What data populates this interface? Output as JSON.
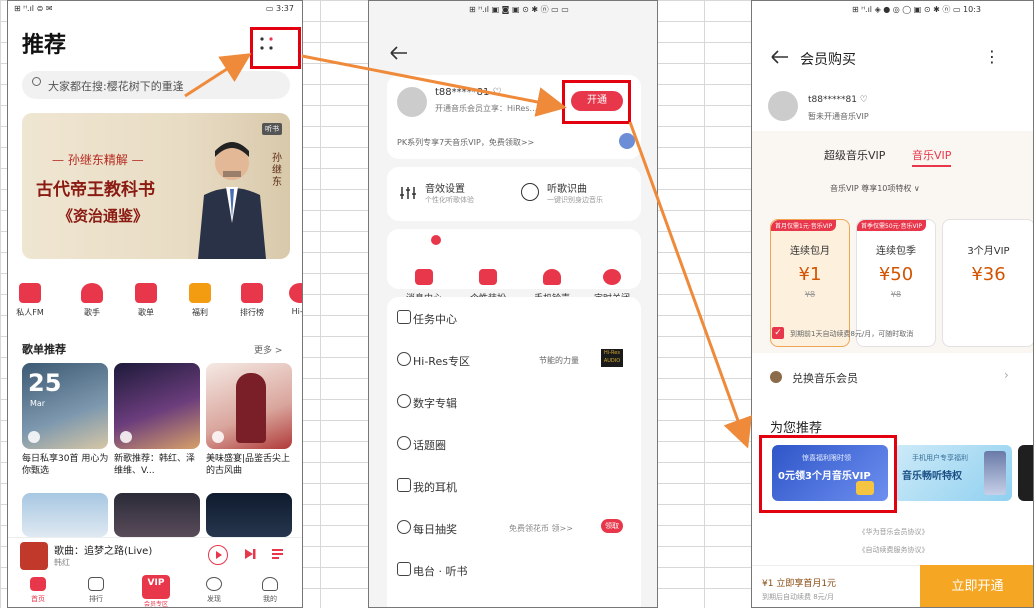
{
  "screen1": {
    "status_left": "⊞ ᴴ.ıl ⊜ ✉",
    "status_right": "▭ 3:37",
    "title": "推荐",
    "search_placeholder": "大家都在搜:樱花树下的重逢",
    "banner": {
      "badge": "听书",
      "line1": "— 孙继东精解 —",
      "line2": "古代帝王教科书",
      "line3": "《资治通鉴》",
      "side_name": "孙继东"
    },
    "quick_items": [
      "私人FM",
      "歌手",
      "歌单",
      "福利",
      "排行榜",
      "Hi-R"
    ],
    "playlist_section": {
      "title": "歌单推荐",
      "more": "更多 >"
    },
    "playlists": [
      {
        "date": "25",
        "month": "Mar",
        "caption": "每日私享30首 用心为你甄选"
      },
      {
        "caption": "新歌推荐：韩红、泽维维、V..."
      },
      {
        "caption": "美味盛宴|品鉴舌尖上的古风曲"
      }
    ],
    "player": {
      "title": "歌曲：追梦之路(Live)",
      "artist": "韩红"
    },
    "tabs": [
      "首页",
      "排行",
      "VIP",
      "发现",
      "我的"
    ],
    "vip_tab_badge": "VIP",
    "vip_tab_sub": "会员专区"
  },
  "screen2": {
    "status": "⊞ ᴴ.ıl ▣ ◙      ▣ ⊙ ✱ ⓝ ▭ ▭",
    "user_name": "t88*****81 ♡",
    "user_sub": "开通音乐会员立享：HiRes...",
    "open_button": "开通",
    "promo": "PK系列专享7天音乐VIP，免费领取>>",
    "sound_settings": {
      "title": "音效设置",
      "sub": "个性化听歌体验"
    },
    "song_id": {
      "title": "听歌识曲",
      "sub": "一键识别身边音乐"
    },
    "grid_items": [
      "消息中心",
      "个性装扮",
      "手机铃声",
      "定时关闭"
    ],
    "menu": [
      {
        "label": "任务中心",
        "right": ""
      },
      {
        "label": "Hi-Res专区",
        "right": "节能的力量"
      },
      {
        "label": "数字专辑",
        "right": ""
      },
      {
        "label": "话题圈",
        "right": ""
      },
      {
        "label": "我的耳机",
        "right": ""
      },
      {
        "label": "每日抽奖",
        "right": "免费领花币 领>>"
      },
      {
        "label": "电台 · 听书",
        "right": ""
      }
    ],
    "lottery_badge": "领取",
    "hires_badge": "Hi-Res AUDIO"
  },
  "screen3": {
    "status": "⊞ ᴴ.ıl ◈ ● ◎ ◯     ▣ ⊙ ✱ ⓝ ▭ 10:3",
    "title": "会员购买",
    "user_name": "t88*****81 ♡",
    "user_sub": "暂未开通音乐VIP",
    "tabs": [
      "超级音乐VIP",
      "音乐VIP"
    ],
    "privilege_line": "音乐VIP 尊享10项特权 ∨",
    "packages": [
      {
        "tag": "首月仅需1元·音乐VIP",
        "name": "连续包月",
        "price": "¥1",
        "orig": "¥8"
      },
      {
        "tag": "首季仅需50元·音乐VIP",
        "name": "连续包季",
        "price": "¥50",
        "orig": "¥8"
      },
      {
        "tag": "",
        "name": "3个月VIP",
        "price": "¥36",
        "orig": ""
      }
    ],
    "agree_text": "到期前1天自动续费8元/月，可随时取消",
    "exchange": "兑换音乐会员",
    "recommend_title": "为您推荐",
    "rec1": {
      "top": "惊喜福利限时领",
      "main": "0元领3个月音乐VIP"
    },
    "rec2": {
      "top": "手机用户专享福利",
      "main": "音乐畅听特权"
    },
    "agreements": [
      "《华为音乐会员协议》",
      "《自动续费服务协议》"
    ],
    "bottom_left": "¥1 立即享首月1元",
    "bottom_left_sub": "到期后自动续费 8元/月",
    "buy_button": "立即开通"
  },
  "colors": {
    "accent_red": "#e8374b",
    "highlight_box": "#e3000f",
    "arrow_orange": "#ef8a3a",
    "buy_orange": "#f5a623"
  }
}
